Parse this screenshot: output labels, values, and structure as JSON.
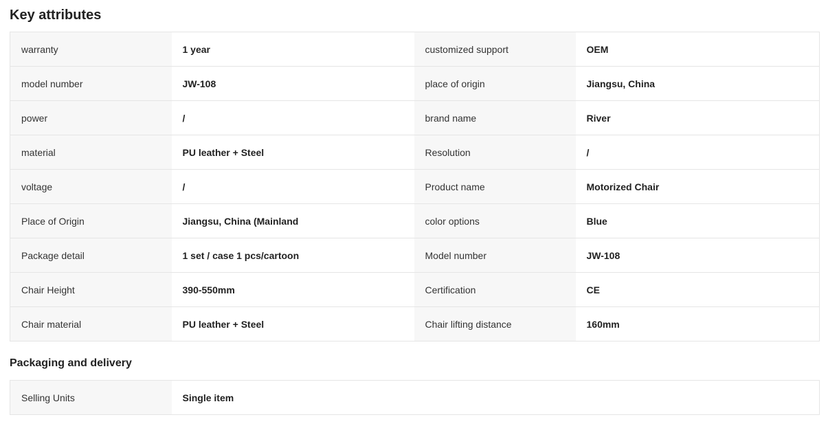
{
  "key_attributes": {
    "title": "Key attributes",
    "rows": [
      [
        {
          "k": "warranty",
          "v": "1 year"
        },
        {
          "k": "customized support",
          "v": "OEM"
        }
      ],
      [
        {
          "k": "model number",
          "v": "JW-108"
        },
        {
          "k": "place of origin",
          "v": "Jiangsu, China"
        }
      ],
      [
        {
          "k": "power",
          "v": "/"
        },
        {
          "k": "brand name",
          "v": "River"
        }
      ],
      [
        {
          "k": "material",
          "v": "PU leather + Steel"
        },
        {
          "k": "Resolution",
          "v": "/"
        }
      ],
      [
        {
          "k": "voltage",
          "v": "/"
        },
        {
          "k": "Product name",
          "v": "Motorized Chair"
        }
      ],
      [
        {
          "k": "Place of Origin",
          "v": "Jiangsu, China (Mainland"
        },
        {
          "k": "color options",
          "v": "Blue"
        }
      ],
      [
        {
          "k": "Package detail",
          "v": "1 set / case 1 pcs/cartoon"
        },
        {
          "k": "Model number",
          "v": "JW-108"
        }
      ],
      [
        {
          "k": "Chair Height",
          "v": "390-550mm"
        },
        {
          "k": "Certification",
          "v": "CE"
        }
      ],
      [
        {
          "k": "Chair material",
          "v": "PU leather + Steel"
        },
        {
          "k": "Chair lifting distance",
          "v": "160mm"
        }
      ]
    ]
  },
  "packaging": {
    "title": "Packaging and delivery",
    "rows": [
      {
        "k": "Selling Units",
        "v": "Single item"
      }
    ]
  }
}
